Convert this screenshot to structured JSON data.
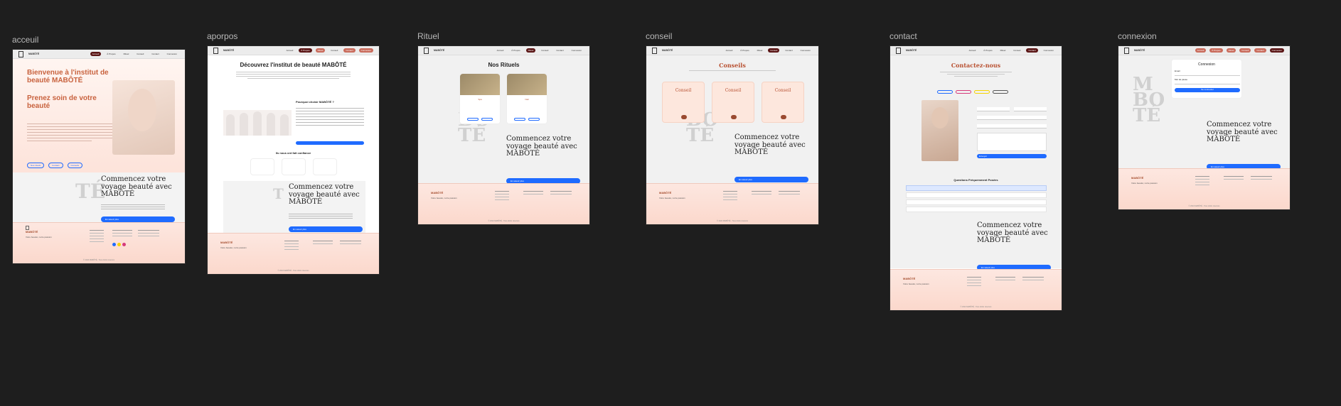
{
  "frames": {
    "acceuil": {
      "label": "acceuil",
      "nav": [
        "Accueil",
        "À Propos",
        "Rituel",
        "Conseil",
        "Contact",
        "Connexion"
      ],
      "hero_title": "Bienvenue à l'institut de beauté MABÔTÉ",
      "hero_subtitle": "Prenez soin de votre beauté",
      "hero_buttons": [
        "Nos rituels",
        "Contact",
        "Conseils"
      ],
      "cta_title": "Commencez votre voyage beauté avec MABÔTÉ",
      "cta_button": "En savoir plus"
    },
    "aporpos": {
      "label": "aporpos",
      "title": "Découvrez l'institut de beauté MABÔTÉ",
      "why_title": "Pourquoi choisir MABÔTÉ ?",
      "trust_title": "Ils nous ont fait confiance",
      "cta_title": "Commencez votre voyage beauté avec MABÔTÉ",
      "cta_button": "En savoir plus"
    },
    "rituel": {
      "label": "Rituel",
      "title": "Nos Rituels",
      "card_names": [
        "Spa",
        "Nail"
      ],
      "cta_title": "Commencez votre voyage beauté avec MABÔTÉ",
      "cta_button": "En savoir plus"
    },
    "conseil": {
      "label": "conseil",
      "title": "Conseils",
      "cards": [
        "Conseil",
        "Conseil",
        "Conseil"
      ],
      "cta_title": "Commencez votre voyage beauté avec MABÔTÉ",
      "cta_button": "En savoir plus"
    },
    "contact": {
      "label": "contact",
      "title": "Contactez-nous",
      "faq_title": "Questions Fréquemment Posées",
      "send_button": "Envoyer",
      "cta_title": "Commencez votre voyage beauté avec MABÔTÉ",
      "cta_button": "En savoir plus"
    },
    "connexion": {
      "label": "connexion",
      "title": "Connexion",
      "email_label": "Email",
      "password_label": "Mot de passe",
      "login_button": "Se connecter",
      "cta_title": "Commencez votre voyage beauté avec MABÔTÉ",
      "cta_button": "En savoir plus"
    }
  },
  "footer": {
    "brand": "MABÔTÉ",
    "tagline": "Votre beauté, notre passion",
    "copyright": "© 2024 MABÔTÉ - Tous droits réservés"
  },
  "colors": {
    "canvas": "#1e1e1e",
    "accent": "#b85030",
    "nav_active": "#5a1414",
    "cta_blue": "#1f6bff"
  }
}
